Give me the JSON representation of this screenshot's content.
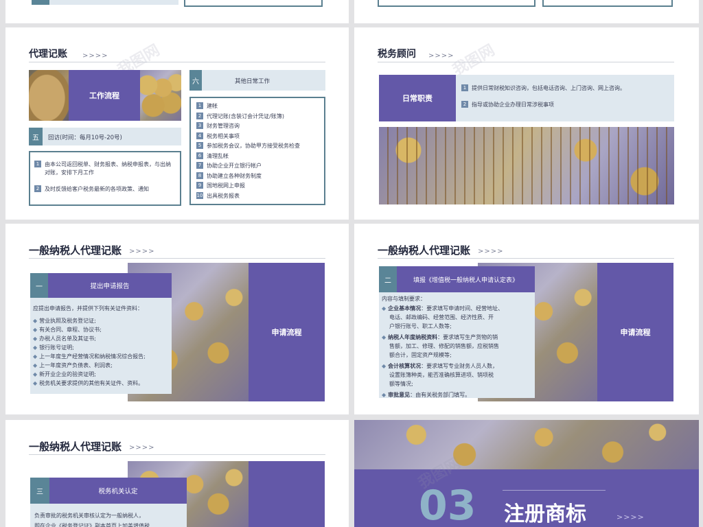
{
  "watermark": "我图网",
  "chevrons": ">>>>",
  "slide_dl_acct": {
    "title": "代理记账",
    "work_flow": "工作流程",
    "six_num": "六",
    "six_label": "其他日常工作",
    "five_num": "五",
    "five_label": "回访(时间：每月10号-20号)",
    "visits": [
      {
        "n": "1",
        "text": "由本公司返回税单、财务报表、纳税申报表，与出纳对账，安排下月工作"
      },
      {
        "n": "2",
        "text": "及时反馈给客户税务最新的各项政策、通知"
      }
    ],
    "tasks": [
      {
        "n": "1",
        "text": "建帐"
      },
      {
        "n": "2",
        "text": "代理记账(含装订会计凭证/账簿)"
      },
      {
        "n": "3",
        "text": "财务管理咨询"
      },
      {
        "n": "4",
        "text": "税务相关事项"
      },
      {
        "n": "5",
        "text": "参加税务会议，协助甲方接受税务检查"
      },
      {
        "n": "6",
        "text": "清理乱帐"
      },
      {
        "n": "7",
        "text": "协助企业开立银行帐户"
      },
      {
        "n": "8",
        "text": "协助建立各种财务制度"
      },
      {
        "n": "9",
        "text": "国地税网上申报"
      },
      {
        "n": "10",
        "text": "出具税务报表"
      }
    ]
  },
  "slide_tax": {
    "title": "税务顾问",
    "duty": "日常职责",
    "items": [
      {
        "n": "1",
        "text": "提供日常财税知识咨询，包括电话咨询、上门咨询、网上咨询。"
      },
      {
        "n": "2",
        "text": "指导或协助企业办理日常涉税事项"
      }
    ]
  },
  "slide_g1": {
    "title": "一般纳税人代理记账",
    "num": "一",
    "header": "提出申请报告",
    "intro": "应提出申请报告，并提供下列有关证件资料：",
    "items": [
      "营业执照及税务登记证;",
      "有关合同、章程、协议书;",
      "办税人员名单及其证书;",
      "银行账号证明;",
      "上一年度生产经营情况和纳税情况综合报告;",
      "上一年度资产负债表、利润表;",
      "新开业企业的验资证明;",
      "税务机关要求提供的其他有关证件、资料。"
    ],
    "flow": "申请流程"
  },
  "slide_g2": {
    "title": "一般纳税人代理记账",
    "num": "二",
    "header": "填报《增值税一般纳税人申请认定表》",
    "intro": "内容与填制要求：",
    "items": [
      {
        "bold": "企业基本情况",
        "lines": [
          "：要求填写申请时间、经营地址、",
          "电话、邮政编码、经营范围、经济性质、开",
          "户银行账号、职工人数等;"
        ]
      },
      {
        "bold": "纳税人年度纳税资料",
        "lines": [
          "：要求填写生产货物的销",
          "售额，加工、修理、修配的销售额，应税销售",
          "额合计，固定资产规模等;"
        ]
      },
      {
        "bold": "会计核算状况",
        "lines": [
          "：要求填写专业财务人员人数，",
          "设置账簿种类，能否准确核算进项、销项税",
          "额等情况;"
        ]
      },
      {
        "bold": "审批意见",
        "lines": [
          "：由有关税务部门填写。"
        ]
      }
    ],
    "flow": "申请流程"
  },
  "slide_g3": {
    "title": "一般纳税人代理记账",
    "num": "三",
    "header": "税务机关认定",
    "lines": [
      "负责审批的税务机关审核认定为一般纳税人，",
      "即在企业《税务登记证》副本首页上加盖增值税"
    ]
  },
  "slide_03": {
    "number": "03",
    "title": "注册商标"
  }
}
